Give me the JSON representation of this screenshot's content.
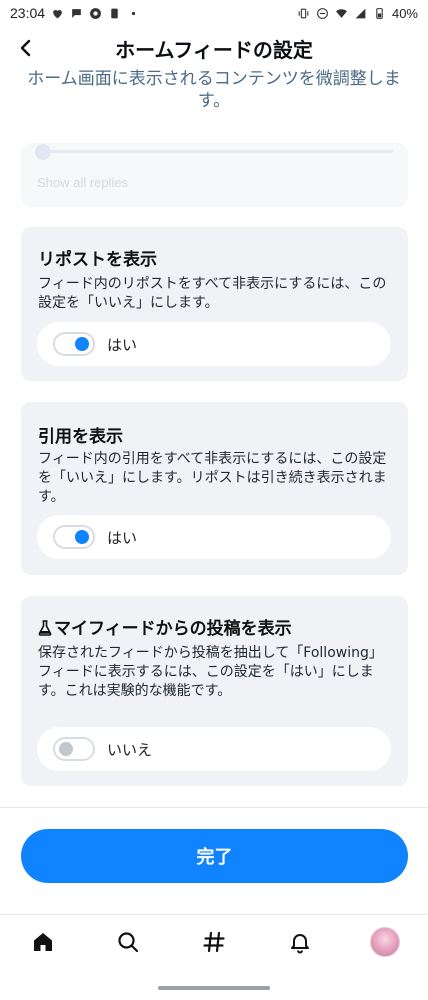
{
  "status_bar": {
    "time": "23:04",
    "battery": "40%",
    "left_icons": [
      "heart-icon",
      "chat-bubble-icon",
      "chrome-icon",
      "sim-icon",
      "dot-icon"
    ],
    "right_icons": [
      "vibrate-icon",
      "do-not-disturb-icon",
      "wifi-icon",
      "signal-icon",
      "battery-icon"
    ]
  },
  "header": {
    "title": "ホームフィードの設定",
    "back_icon": "chevron-left-icon"
  },
  "subtitle": "ホーム画面に表示されるコンテンツを微調整します。",
  "top_card": {
    "faded_label": "Show all replies"
  },
  "sections": [
    {
      "title": "リポストを表示",
      "description": "フィード内のリポストをすべて非表示にするには、この設定を「いいえ」にします。",
      "toggle_label": "はい",
      "toggle_on": true
    },
    {
      "title": "引用を表示",
      "description": "フィード内の引用をすべて非表示にするには、この設定を「いいえ」にします。リポストは引き続き表示されます。",
      "toggle_label": "はい",
      "toggle_on": true
    },
    {
      "title": "マイフィードからの投稿を表示",
      "title_icon": "flask-icon",
      "description": "保存されたフィードから投稿を抽出して「Following」フィードに表示するには、この設定を「はい」にします。これは実験的な機能です。",
      "toggle_label": "いいえ",
      "toggle_on": false
    }
  ],
  "done_button": "完了",
  "tab_bar": [
    "home-icon",
    "search-icon",
    "feeds-hash-icon",
    "notifications-bell-icon",
    "profile-avatar"
  ],
  "colors": {
    "accent": "#1083fe",
    "card_bg": "#f0f2f5",
    "subtitle": "#4b6a86"
  }
}
